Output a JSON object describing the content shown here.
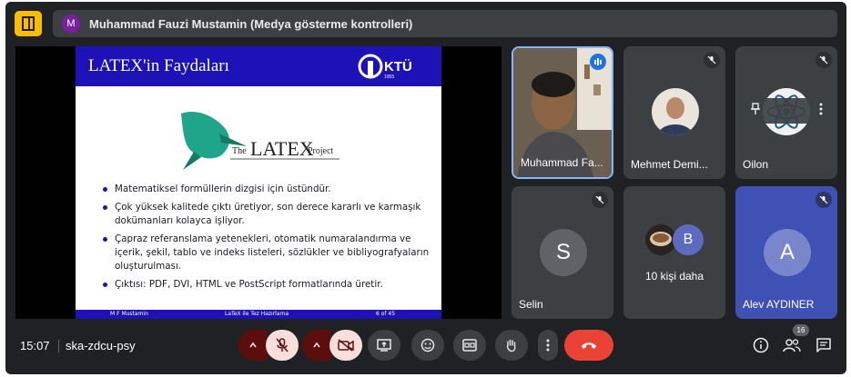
{
  "top_bar": {
    "presenter_initial": "M",
    "presenter_label": "Muhammad Fauzi Mustamin (Medya gösterme kontrolleri)"
  },
  "slide": {
    "title": "LATEX'in Faydaları",
    "logo_text": "KTÜ",
    "logo_year": "1955",
    "latex_logo_prefix": "The",
    "latex_logo_word": "LATEX",
    "latex_logo_suffix": "Project",
    "bullets": [
      "Matematiksel formüllerin dizgisi için üstündür.",
      "Çok yüksek kalitede çıktı üretiyor, son derece kararlı ve karmaşık dokümanları kolayca işliyor.",
      "Çapraz referanslama yetenekleri, otomatik numaralandırma ve içerik, şekil, tablo ve indeks listeleri, sözlükler ve bibliyografyaların oluşturulması.",
      "Çıktısı: PDF, DVI, HTML ve PostScript formatlarında üretir."
    ],
    "footer_author": "M F Mustamin",
    "footer_title": "LaTeX ile Tez Hazırlama",
    "footer_page": "6 of 45"
  },
  "participants": [
    {
      "name": "Muhammad Fa...",
      "state": "speaking"
    },
    {
      "name": "Mehmet Demi...",
      "state": "muted"
    },
    {
      "name": "Oilon",
      "state": "muted"
    },
    {
      "name": "Selin",
      "initial": "S",
      "state": "muted",
      "color": "#3c4043"
    },
    {
      "name": "Alev AYDINER",
      "initial": "A",
      "state": "muted",
      "color": "#7986cb"
    }
  ],
  "others": {
    "initial": "B",
    "label": "10 kişi daha",
    "color": "#5c6bc0"
  },
  "bottom_bar": {
    "time": "15:07",
    "meeting_code": "ska-zdcu-psy",
    "people_count": "16"
  },
  "colors": {
    "background": "#202124",
    "tile": "#3c4043",
    "accent_yellow": "#fbbc04",
    "end_call": "#ea4335",
    "slide_blue": "#1c12b8",
    "off_button": "#f9dedc"
  }
}
